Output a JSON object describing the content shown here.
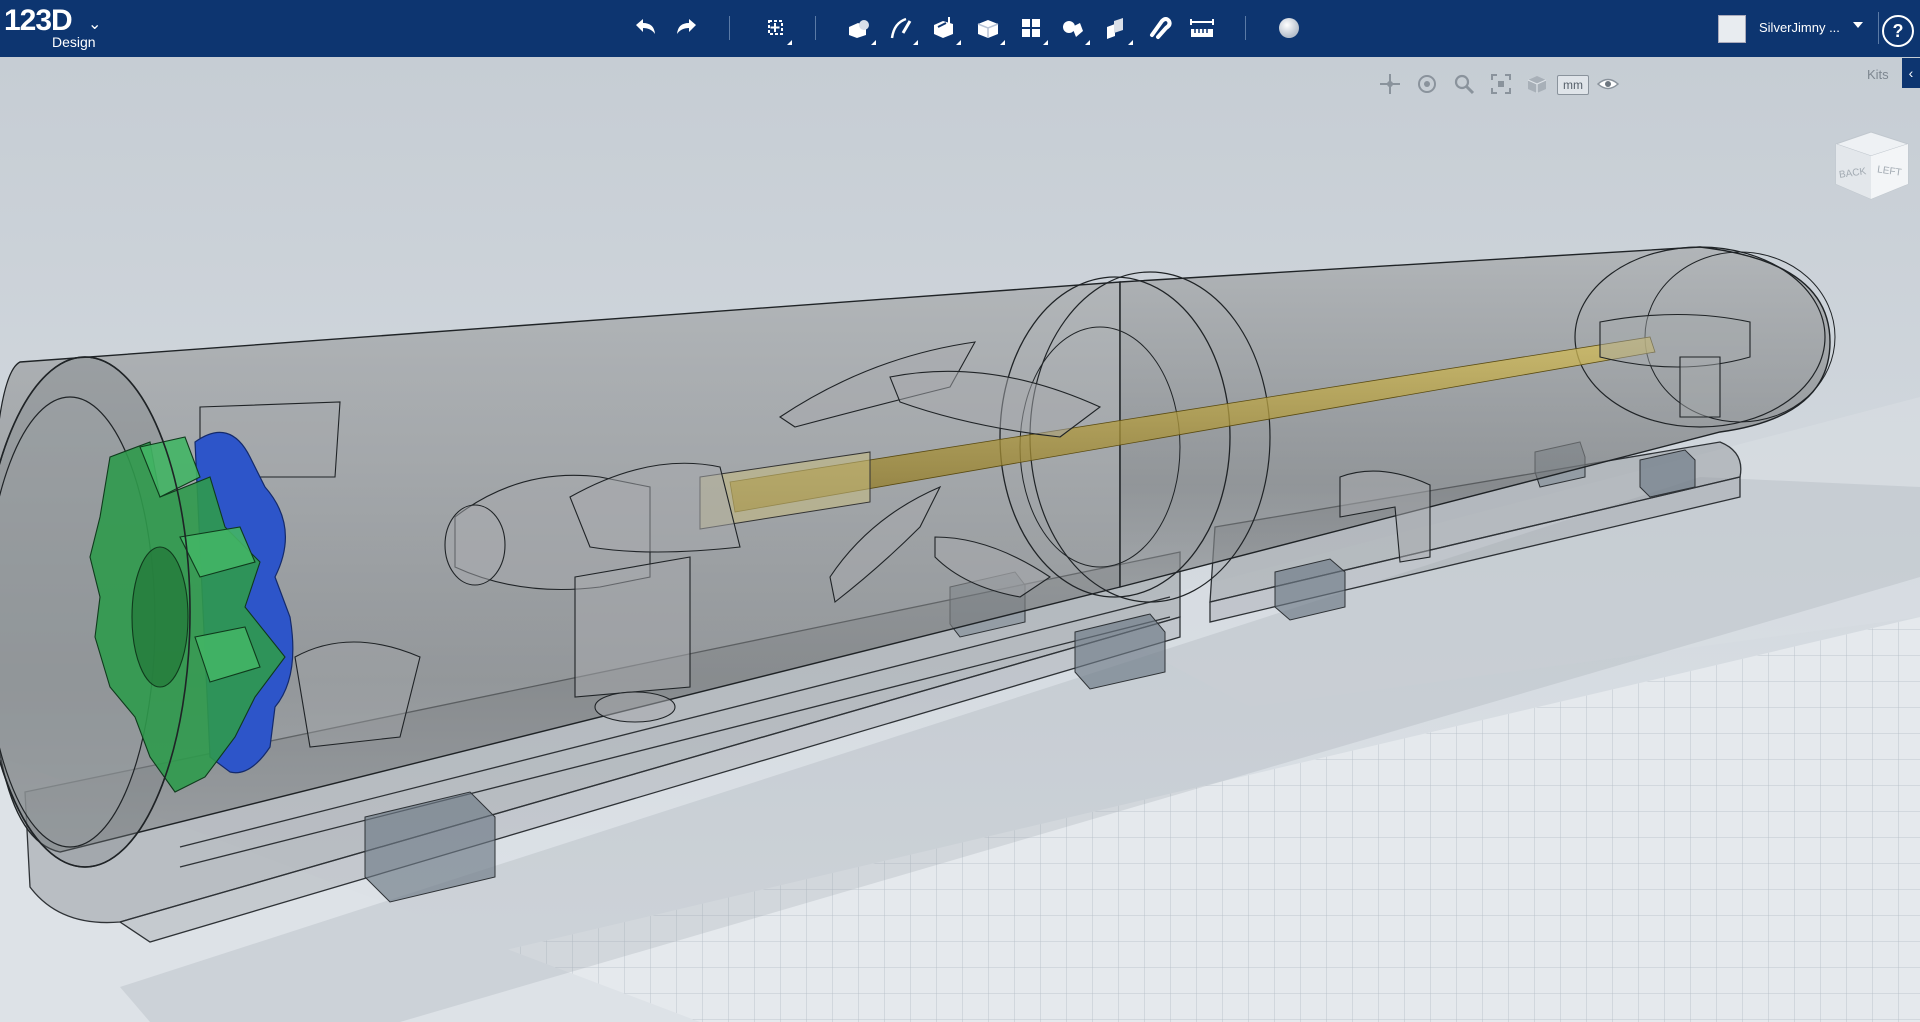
{
  "app": {
    "logo_number": "123D",
    "logo_subtitle": "Design"
  },
  "toolbar": {
    "tools": [
      {
        "name": "undo-icon"
      },
      {
        "name": "redo-icon"
      },
      {
        "name": "transform-icon"
      },
      {
        "name": "primitives-icon"
      },
      {
        "name": "sketch-icon"
      },
      {
        "name": "construct-icon"
      },
      {
        "name": "modify-icon"
      },
      {
        "name": "pattern-icon"
      },
      {
        "name": "grouping-icon"
      },
      {
        "name": "combine-icon"
      },
      {
        "name": "snap-icon"
      },
      {
        "name": "measure-icon"
      },
      {
        "name": "material-icon"
      }
    ]
  },
  "user": {
    "name": "SilverJimny ..."
  },
  "help": {
    "label": "?"
  },
  "navbar": {
    "units_label": "mm"
  },
  "kits": {
    "label": "Kits",
    "toggle": "‹"
  },
  "viewcube": {
    "face_back": "BACK",
    "face_left": "LEFT"
  },
  "colors": {
    "toolbar_bg": "#0d3570",
    "viewport_bg": "#c9d1d9",
    "gear_green": "#2f9a4c",
    "gear_blue": "#2d55c9",
    "rod_gold": "#b79a2e"
  }
}
